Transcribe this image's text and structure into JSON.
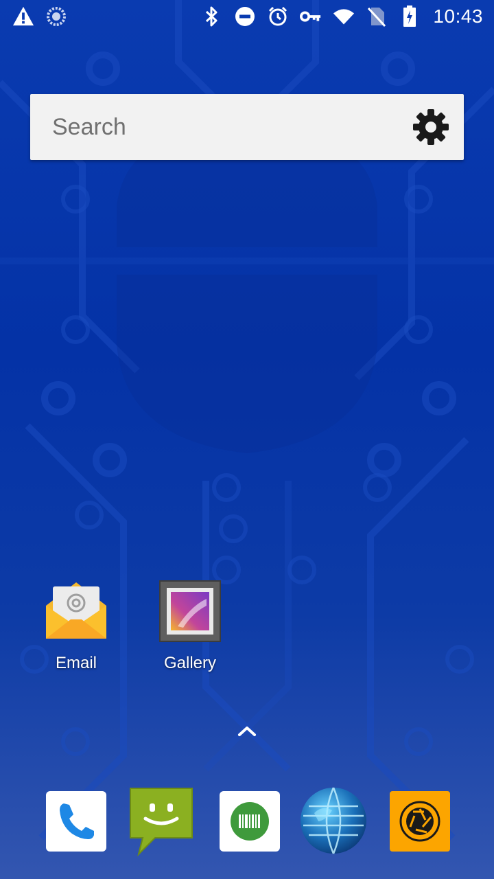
{
  "status_bar": {
    "time": "10:43",
    "left_icons": [
      "warning-icon",
      "sync-loading-icon"
    ],
    "right_icons": [
      "bluetooth-icon",
      "do-not-disturb-icon",
      "alarm-icon",
      "vpn-key-icon",
      "wifi-icon",
      "no-sim-icon",
      "battery-charging-icon"
    ]
  },
  "search": {
    "placeholder": "Search",
    "settings_icon": "gear-icon"
  },
  "apps": [
    {
      "label": "Email",
      "icon": "email-icon"
    },
    {
      "label": "Gallery",
      "icon": "gallery-icon"
    }
  ],
  "dock": [
    {
      "icon": "phone-icon"
    },
    {
      "icon": "messaging-icon"
    },
    {
      "icon": "barcode-scanner-icon"
    },
    {
      "icon": "browser-globe-icon"
    },
    {
      "icon": "camera-icon"
    }
  ],
  "app_drawer_handle": "chevron-up-icon",
  "colors": {
    "wallpaper": "#0a3bb0",
    "search_bg": "#f2f2f2",
    "camera_bg": "#fca500",
    "messaging_bg": "#8bb021",
    "phone_blue": "#1e88e5"
  }
}
